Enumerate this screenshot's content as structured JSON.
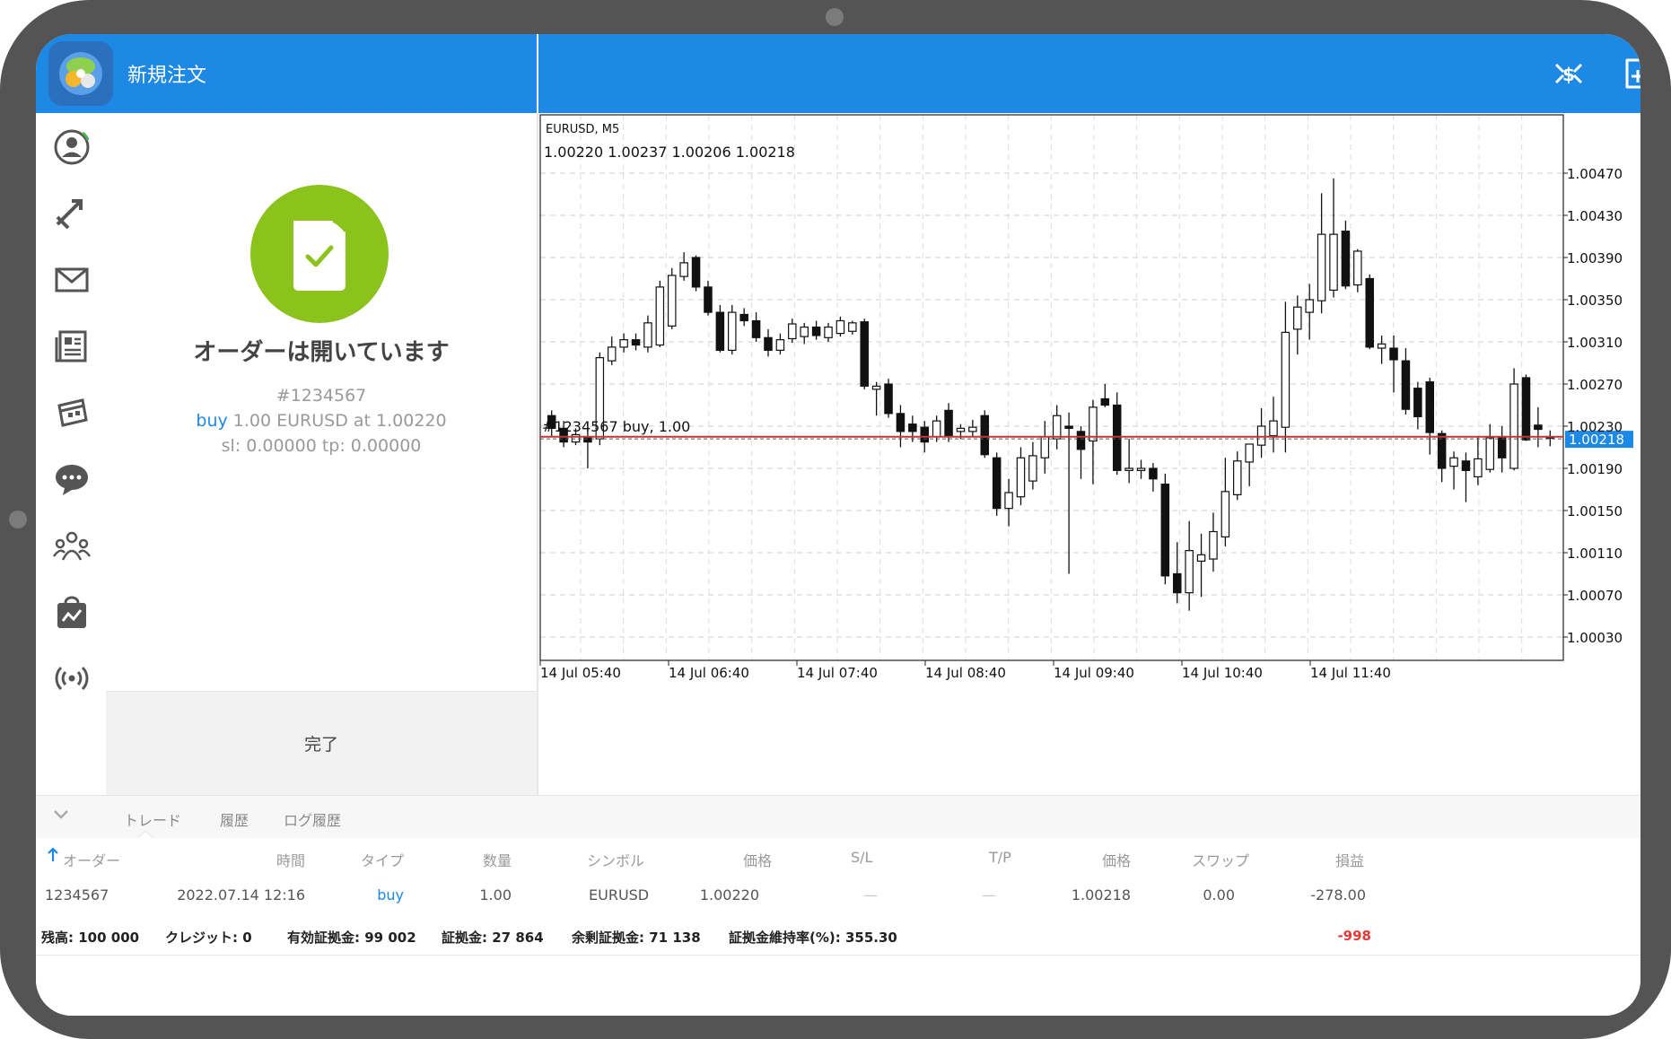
{
  "header": {
    "title": "新規注文"
  },
  "order_panel": {
    "status_title": "オーダーは開いています",
    "order_number": "#1234567",
    "buy_word": "buy",
    "detail_rest": " 1.00 EURUSD at 1.00220",
    "sl_tp": "sl: 0.00000 tp: 0.00000",
    "done_label": "完了"
  },
  "chart": {
    "symbol_label": "EURUSD, M5",
    "ohlc_label": "1.00220 1.00237 1.00206 1.00218",
    "order_line_label": "#1234567    buy, 1.00",
    "current_price_label": "1.00218",
    "accent_color": "#1e88e5",
    "order_line_color": "#c0393b"
  },
  "chart_data": {
    "type": "candlestick",
    "title": "EURUSD, M5",
    "y_ticks": [
      "1.00470",
      "1.00430",
      "1.00390",
      "1.00350",
      "1.00310",
      "1.00270",
      "1.00230",
      "1.00190",
      "1.00150",
      "1.00110",
      "1.00070",
      "1.00030"
    ],
    "x_ticks": [
      "14 Jul 05:40",
      "14 Jul 06:40",
      "14 Jul 07:40",
      "14 Jul 08:40",
      "14 Jul 09:40",
      "14 Jul 10:40",
      "14 Jul 11:40"
    ],
    "ylim": [
      1.0,
      1.0049
    ],
    "current_price": 1.00218,
    "order_price": 1.0022,
    "candles": [
      [
        1.0024,
        1.00245,
        1.0022,
        1.00228
      ],
      [
        1.00228,
        1.00235,
        1.0021,
        1.00215
      ],
      [
        1.00215,
        1.00228,
        1.00212,
        1.00222
      ],
      [
        1.0022,
        1.00225,
        1.0019,
        1.00215
      ],
      [
        1.00218,
        1.003,
        1.00212,
        1.00295
      ],
      [
        1.00292,
        1.00315,
        1.00288,
        1.00305
      ],
      [
        1.00305,
        1.00318,
        1.003,
        1.00312
      ],
      [
        1.00312,
        1.00318,
        1.00302,
        1.00307
      ],
      [
        1.00305,
        1.00335,
        1.003,
        1.00328
      ],
      [
        1.00307,
        1.00368,
        1.00305,
        1.00362
      ],
      [
        1.00325,
        1.0038,
        1.00322,
        1.00373
      ],
      [
        1.00372,
        1.00395,
        1.00368,
        1.00385
      ],
      [
        1.0039,
        1.00392,
        1.00358,
        1.00362
      ],
      [
        1.00362,
        1.00368,
        1.00335,
        1.00338
      ],
      [
        1.00338,
        1.00345,
        1.003,
        1.00302
      ],
      [
        1.00302,
        1.00345,
        1.00298,
        1.00338
      ],
      [
        1.00336,
        1.00342,
        1.00325,
        1.0033
      ],
      [
        1.0033,
        1.00338,
        1.0031,
        1.00314
      ],
      [
        1.00314,
        1.00322,
        1.00296,
        1.00302
      ],
      [
        1.00302,
        1.00318,
        1.00298,
        1.00312
      ],
      [
        1.00313,
        1.00332,
        1.00309,
        1.00327
      ],
      [
        1.00315,
        1.00328,
        1.00308,
        1.00324
      ],
      [
        1.00324,
        1.0033,
        1.00312,
        1.00316
      ],
      [
        1.00314,
        1.00328,
        1.0031,
        1.00324
      ],
      [
        1.00318,
        1.00334,
        1.00315,
        1.0033
      ],
      [
        1.0032,
        1.0033,
        1.00317,
        1.00328
      ],
      [
        1.00329,
        1.00332,
        1.00265,
        1.00268
      ],
      [
        1.00265,
        1.00272,
        1.0024,
        1.00268
      ],
      [
        1.0027,
        1.00275,
        1.00238,
        1.00242
      ],
      [
        1.00242,
        1.0025,
        1.0021,
        1.00225
      ],
      [
        1.00232,
        1.0024,
        1.00215,
        1.00225
      ],
      [
        1.00229,
        1.00235,
        1.00205,
        1.00215
      ],
      [
        1.0022,
        1.0024,
        1.00215,
        1.00235
      ],
      [
        1.00245,
        1.00252,
        1.00215,
        1.0022
      ],
      [
        1.00225,
        1.00232,
        1.00218,
        1.00228
      ],
      [
        1.00225,
        1.00236,
        1.0022,
        1.00229
      ],
      [
        1.0024,
        1.00245,
        1.002,
        1.00203
      ],
      [
        1.002,
        1.00205,
        1.00145,
        1.00152
      ],
      [
        1.00152,
        1.0018,
        1.00135,
        1.00167
      ],
      [
        1.00163,
        1.0021,
        1.00155,
        1.002
      ],
      [
        1.00178,
        1.00215,
        1.0017,
        1.00202
      ],
      [
        1.002,
        1.00235,
        1.00185,
        1.0022
      ],
      [
        1.00218,
        1.0025,
        1.00208,
        1.0024
      ],
      [
        1.0023,
        1.00243,
        1.0009,
        1.00228
      ],
      [
        1.00225,
        1.0023,
        1.0018,
        1.00208
      ],
      [
        1.00216,
        1.00255,
        1.00175,
        1.00248
      ],
      [
        1.00256,
        1.0027,
        1.00248,
        1.0025
      ],
      [
        1.0025,
        1.00262,
        1.00184,
        1.00188
      ],
      [
        1.00188,
        1.00218,
        1.00176,
        1.0019
      ],
      [
        1.00188,
        1.00198,
        1.0018,
        1.0019
      ],
      [
        1.0019,
        1.00195,
        1.00168,
        1.0018
      ],
      [
        1.00175,
        1.00185,
        1.0008,
        1.00088
      ],
      [
        1.0009,
        1.0012,
        1.00062,
        1.00072
      ],
      [
        1.00072,
        1.0014,
        1.00055,
        1.00112
      ],
      [
        1.00102,
        1.00128,
        1.00068,
        1.00108
      ],
      [
        1.00104,
        1.00148,
        1.00092,
        1.0013
      ],
      [
        1.00125,
        1.002,
        1.00116,
        1.00168
      ],
      [
        1.00165,
        1.00206,
        1.0016,
        1.00197
      ],
      [
        1.00196,
        1.00212,
        1.00173,
        1.00213
      ],
      [
        1.00212,
        1.00247,
        1.002,
        1.0023
      ],
      [
        1.00221,
        1.00258,
        1.00205,
        1.00235
      ],
      [
        1.00229,
        1.00348,
        1.00205,
        1.00319
      ],
      [
        1.00322,
        1.00354,
        1.00298,
        1.00343
      ],
      [
        1.00338,
        1.00365,
        1.00312,
        1.0035
      ],
      [
        1.00349,
        1.00451,
        1.00337,
        1.00412
      ],
      [
        1.00359,
        1.00465,
        1.00352,
        1.00412
      ],
      [
        1.00415,
        1.00425,
        1.0036,
        1.00363
      ],
      [
        1.00364,
        1.00398,
        1.00357,
        1.00396
      ],
      [
        1.0037,
        1.00374,
        1.00303,
        1.00305
      ],
      [
        1.00304,
        1.00316,
        1.00289,
        1.00308
      ],
      [
        1.00304,
        1.00316,
        1.00262,
        1.00293
      ],
      [
        1.00292,
        1.00304,
        1.00241,
        1.00246
      ],
      [
        1.00266,
        1.00272,
        1.00227,
        1.00239
      ],
      [
        1.00272,
        1.00276,
        1.00203,
        1.00224
      ],
      [
        1.00223,
        1.00226,
        1.00177,
        1.0019
      ],
      [
        1.00192,
        1.00206,
        1.0017,
        1.002
      ],
      [
        1.00197,
        1.00205,
        1.00158,
        1.00188
      ],
      [
        1.00182,
        1.0022,
        1.00174,
        1.00199
      ],
      [
        1.00189,
        1.00232,
        1.00186,
        1.00219
      ],
      [
        1.0022,
        1.0023,
        1.00186,
        1.002
      ],
      [
        1.0019,
        1.00285,
        1.00188,
        1.0027
      ],
      [
        1.00276,
        1.00279,
        1.00216,
        1.00217
      ],
      [
        1.00231,
        1.00248,
        1.0021,
        1.00227
      ],
      [
        1.0022,
        1.00226,
        1.00211,
        1.00219
      ]
    ]
  },
  "bottom": {
    "tabs": [
      "トレード",
      "履歴",
      "ログ履歴"
    ],
    "columns": {
      "order": "オーダー",
      "time": "時間",
      "type": "タイプ",
      "volume": "数量",
      "symbol": "シンボル",
      "price": "価格",
      "sl": "S/L",
      "tp": "T/P",
      "price2": "価格",
      "swap": "スワップ",
      "profit": "損益"
    },
    "row": {
      "order": "1234567",
      "time": "2022.07.14 12:16",
      "type": "buy",
      "volume": "1.00",
      "symbol": "EURUSD",
      "price": "1.00220",
      "sl": "—",
      "tp": "—",
      "price2": "1.00218",
      "swap": "0.00",
      "profit": "-278.00"
    },
    "summary": {
      "balance": "残高:  100 000",
      "credit": "クレジット:  0",
      "equity": "有効証拠金:  99 002",
      "margin": "証拠金:  27 864",
      "free_margin": "余剰証拠金:  71 138",
      "margin_level": "証拠金維持率(%):  355.30",
      "total": "-998",
      "total_color": "#e53935"
    }
  }
}
